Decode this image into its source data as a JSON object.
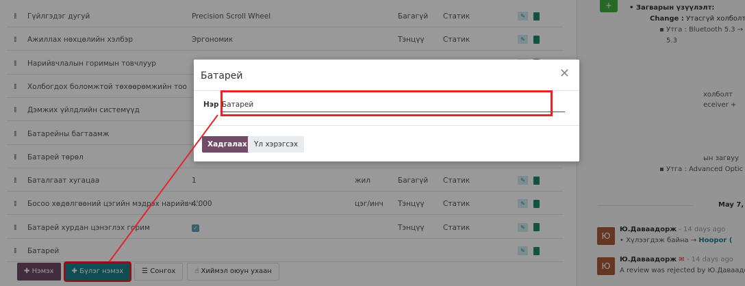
{
  "rows": [
    {
      "name": "Гүйлгэдэг дугуй",
      "value": "Precision Scroll Wheel",
      "unit": "",
      "required": "Багагүй",
      "type": "Статик"
    },
    {
      "name": "Ажиллах нөхцөлийн хэлбэр",
      "value": "Эргономик",
      "unit": "",
      "required": "Тэнцүү",
      "type": "Статик"
    },
    {
      "name": "Нарийвчлалын горимын товчлуур",
      "value": "",
      "unit": "",
      "required": "",
      "type": ""
    },
    {
      "name": "Холбогдох боломжтой төхөөрөмжийн тоо",
      "value": "",
      "unit": "",
      "required": "",
      "type": ""
    },
    {
      "name": "Дэмжих үйлдлийн системүүд",
      "value": "",
      "unit": "",
      "required": "",
      "type": ""
    },
    {
      "name": "Батарейны багтаамж",
      "value": "",
      "unit": "",
      "required": "",
      "type": ""
    },
    {
      "name": "Батарей төрөл",
      "value": "",
      "unit": "",
      "required": "",
      "type": ""
    },
    {
      "name": "Баталгаат хугацаа",
      "value": "1",
      "unit": "жил",
      "required": "Багагүй",
      "type": "Статик"
    },
    {
      "name": "Босоо хөдөлгөөний цэгийн мэдрэх нарийвч...",
      "value": "4'000",
      "unit": "цэг/инч",
      "required": "Тэнцүү",
      "type": "Статик"
    },
    {
      "name": "Батарей хурдан цэнэглэх горим",
      "value": "",
      "unit": "",
      "required": "Тэнцүү",
      "type": "Статик"
    },
    {
      "name": "Батарей",
      "value": "",
      "unit": "",
      "required": "",
      "type": ""
    }
  ],
  "buttons": {
    "add": "Нэмэх",
    "add_group": "Бүлэг нэмэх",
    "select": "Сонгох",
    "ai": "Хиймэл оюун ухаан"
  },
  "chatter": {
    "changes_title": "Загварын үзүүлэлт:",
    "change_label": "Change :",
    "change_text": "Утасгүй холболт",
    "line1": "Утга : Bluetooth 5.3 →",
    "line1b": "5.3",
    "frag1": "холболт",
    "frag2": "eceiver +",
    "frag3": "ын загвуу",
    "line2": "Утга : Advanced Optic",
    "date": "May 7,",
    "avatar_letter": "Ю",
    "user1": "Ю.Даваадорж",
    "time1": "- 14 days ago",
    "msg1a": "Хүлээгдэж байна",
    "msg1b": "Hoopor (",
    "user2": "Ю.Даваадорж",
    "time2": "- 14 days ago",
    "msg2": "A review was rejected by Ю.Даваадор"
  },
  "modal": {
    "title": "Батарей",
    "name_label": "Нэр",
    "name_value": "Батарей",
    "save": "Хадгалах",
    "discard": "Үл хэрэгсэх"
  },
  "colors": {
    "primary": "#714b67",
    "teal": "#1a7f8a",
    "annotation": "#e3242b"
  }
}
